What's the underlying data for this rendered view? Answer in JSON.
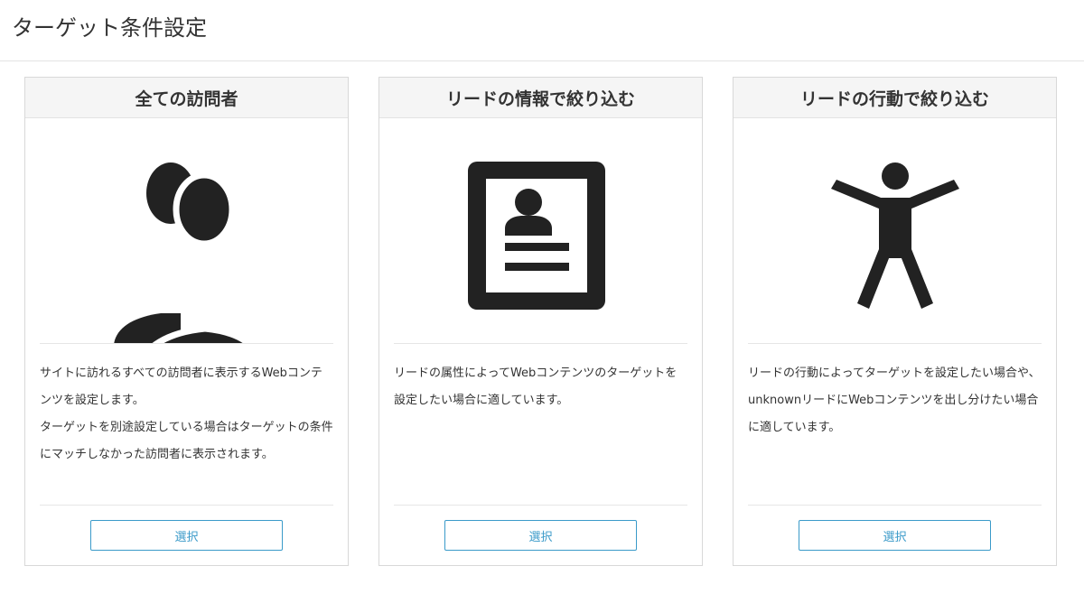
{
  "page": {
    "title": "ターゲット条件設定"
  },
  "cards": [
    {
      "title": "全ての訪問者",
      "icon": "users-icon",
      "description": [
        "サイトに訪れるすべての訪問者に表示するWebコンテンツを設定します。",
        "ターゲットを別途設定している場合はターゲットの条件にマッチしなかった訪問者に表示されます。"
      ],
      "button_label": "選択"
    },
    {
      "title": "リードの情報で絞り込む",
      "icon": "profile-card-icon",
      "description": [
        "リードの属性によってWebコンテンツのターゲットを設定したい場合に適しています。"
      ],
      "button_label": "選択"
    },
    {
      "title": "リードの行動で絞り込む",
      "icon": "person-action-icon",
      "description": [
        "リードの行動によってターゲットを設定したい場合や、unknownリードにWebコンテンツを出し分けたい場合に適しています。"
      ],
      "button_label": "選択"
    }
  ],
  "colors": {
    "accent": "#3a9ac9",
    "icon": "#222222",
    "card_header_bg": "#f5f5f5",
    "border": "#d8d8d8"
  }
}
